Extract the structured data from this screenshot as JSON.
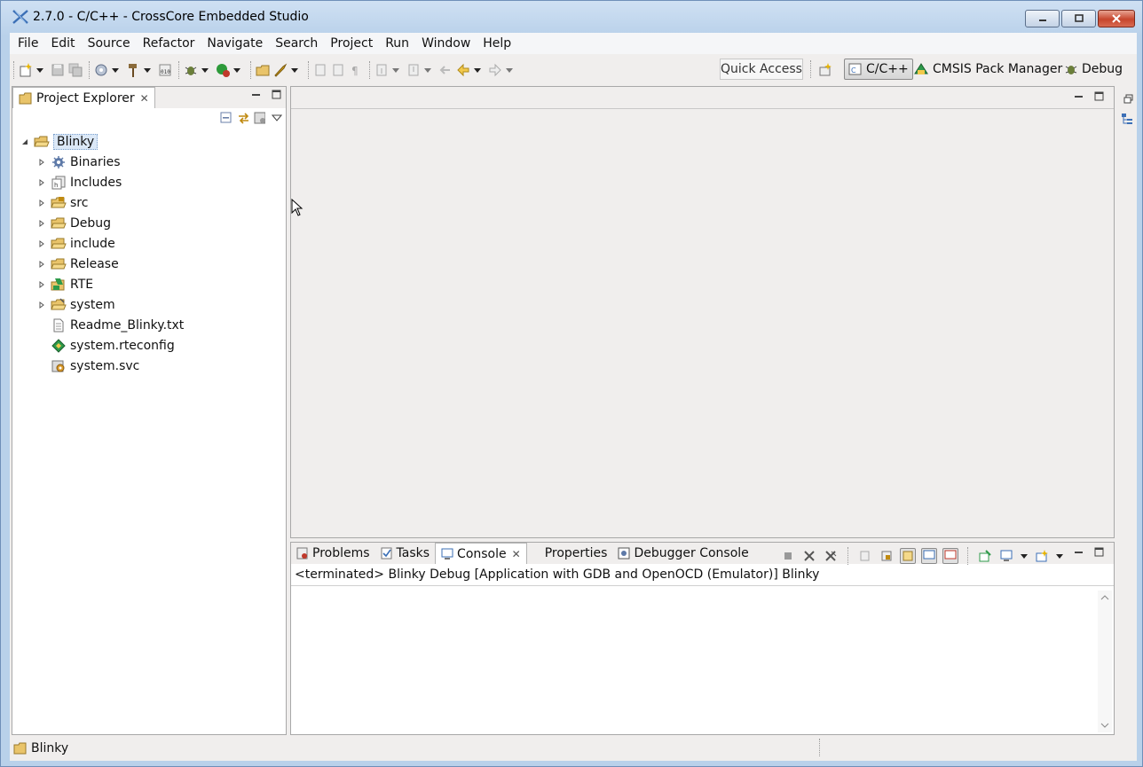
{
  "window": {
    "title": "2.7.0 - C/C++ - CrossCore Embedded Studio"
  },
  "menu": [
    "File",
    "Edit",
    "Source",
    "Refactor",
    "Navigate",
    "Search",
    "Project",
    "Run",
    "Window",
    "Help"
  ],
  "toolbar": {
    "quick_access_label": "Quick Access",
    "perspectives": [
      {
        "label": "C/C++",
        "icon": "cpp-perspective-icon",
        "active": true
      },
      {
        "label": "CMSIS Pack Manager",
        "icon": "pack-manager-icon",
        "active": false
      },
      {
        "label": "Debug",
        "icon": "bug-icon",
        "active": false
      }
    ]
  },
  "project_explorer": {
    "tab_label": "Project Explorer",
    "root": {
      "label": "Blinky",
      "icon": "open-project-icon"
    },
    "children": [
      {
        "label": "Binaries",
        "icon": "binaries-icon",
        "expandable": true
      },
      {
        "label": "Includes",
        "icon": "includes-icon",
        "expandable": true
      },
      {
        "label": "src",
        "icon": "source-folder-icon",
        "expandable": true
      },
      {
        "label": "Debug",
        "icon": "folder-icon",
        "expandable": true
      },
      {
        "label": "include",
        "icon": "folder-icon",
        "expandable": true
      },
      {
        "label": "Release",
        "icon": "folder-icon",
        "expandable": true
      },
      {
        "label": "RTE",
        "icon": "rte-icon",
        "expandable": true
      },
      {
        "label": "system",
        "icon": "source-folder-icon",
        "expandable": true
      },
      {
        "label": "Readme_Blinky.txt",
        "icon": "text-file-icon",
        "expandable": false
      },
      {
        "label": "system.rteconfig",
        "icon": "rteconfig-icon",
        "expandable": false
      },
      {
        "label": "system.svc",
        "icon": "svc-file-icon",
        "expandable": false
      }
    ]
  },
  "bottom_panel": {
    "tabs": [
      {
        "label": "Problems",
        "icon": "problems-icon",
        "active": false
      },
      {
        "label": "Tasks",
        "icon": "tasks-icon",
        "active": false
      },
      {
        "label": "Console",
        "icon": "console-icon",
        "active": true
      },
      {
        "label": "Properties",
        "icon": "",
        "active": false
      },
      {
        "label": "Debugger Console",
        "icon": "debugger-console-icon",
        "active": false
      }
    ],
    "console_header": "<terminated> Blinky Debug [Application with GDB and OpenOCD (Emulator)] Blinky"
  },
  "status": {
    "selection": "Blinky"
  },
  "colors": {
    "title_gradient_top": "#cfe0f3",
    "workbench_bg": "#f0eeed",
    "close_button": "#c7452c",
    "selection_bg": "#dbe8f7"
  }
}
